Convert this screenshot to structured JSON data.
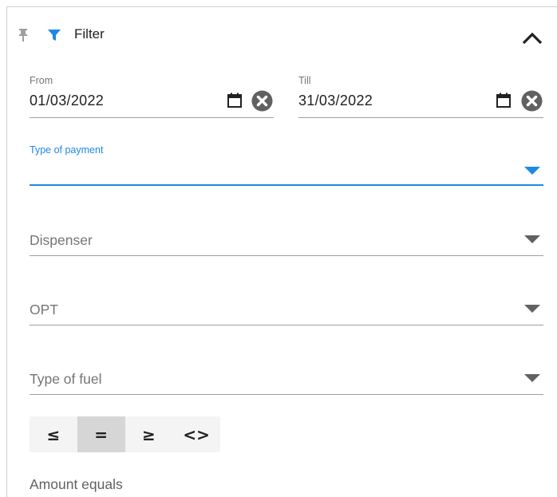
{
  "header": {
    "title": "Filter",
    "collapse_icon": "chevron-up-icon"
  },
  "colors": {
    "accent": "#1e88e5",
    "text": "#212121",
    "muted": "#757575",
    "divider": "#9e9e9e",
    "icon_dark": "#424242"
  },
  "from": {
    "label": "From",
    "value": "01/03/2022"
  },
  "till": {
    "label": "Till",
    "value": "31/03/2022"
  },
  "payment": {
    "label": "Type of payment",
    "value": ""
  },
  "dispenser": {
    "label": "Dispenser"
  },
  "opt": {
    "label": "OPT"
  },
  "fuel": {
    "label": "Type of fuel"
  },
  "comparators": [
    {
      "symbol": "≤",
      "active": false
    },
    {
      "symbol": "=",
      "active": true
    },
    {
      "symbol": "≥",
      "active": false
    },
    {
      "symbol": "<>",
      "active": false
    }
  ],
  "amount": {
    "label": "Amount equals"
  }
}
